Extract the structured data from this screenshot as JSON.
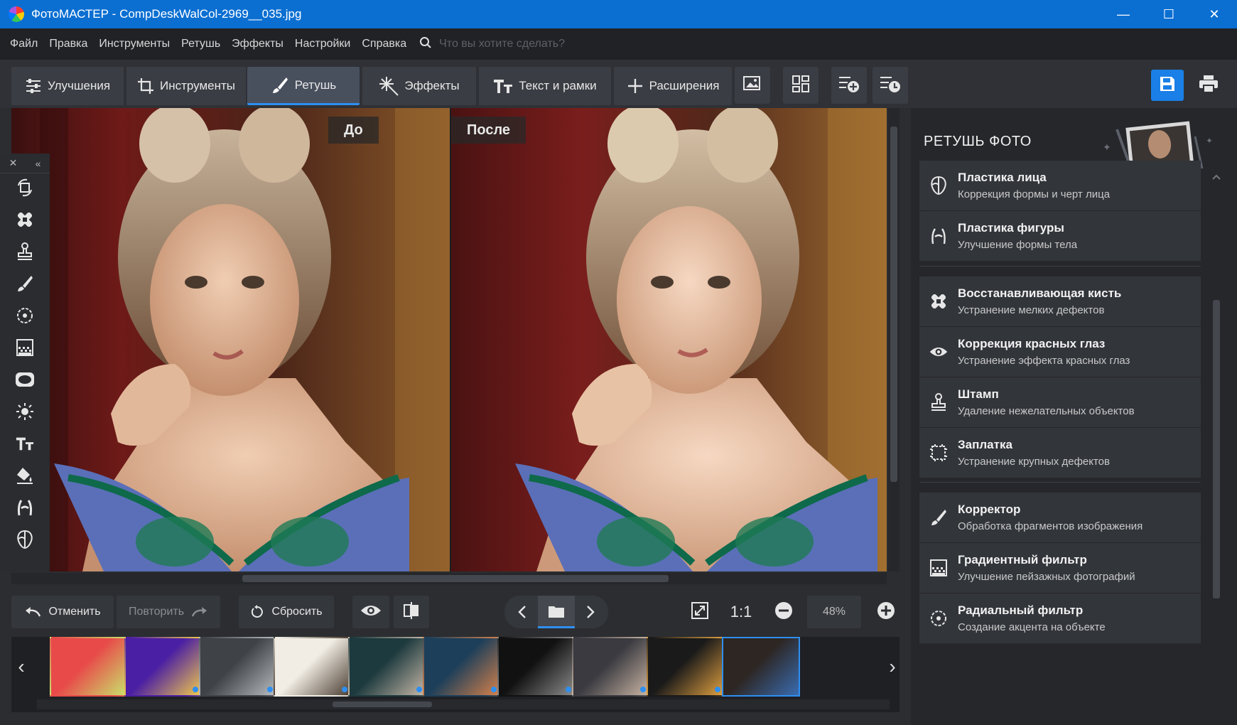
{
  "window": {
    "title": "ФотоМАСТЕР - CompDeskWalCol-2969__035.jpg",
    "minimize": "—",
    "maximize": "☐",
    "close": "✕"
  },
  "menu": {
    "items": [
      "Файл",
      "Правка",
      "Инструменты",
      "Ретушь",
      "Эффекты",
      "Настройки",
      "Справка"
    ],
    "search_placeholder": "Что вы хотите сделать?"
  },
  "toolbar": {
    "tabs": [
      {
        "label": "Улучшения",
        "icon": "sliders-icon"
      },
      {
        "label": "Инструменты",
        "icon": "crop-icon"
      },
      {
        "label": "Ретушь",
        "icon": "brush-icon",
        "active": true
      },
      {
        "label": "Эффекты",
        "icon": "sparkle-icon"
      },
      {
        "label": "Текст и рамки",
        "icon": "text-icon"
      },
      {
        "label": "Расширения",
        "icon": "plus-icon"
      }
    ],
    "icons": [
      "image-icon",
      "grid-icon",
      "add-adjust-icon",
      "time-adjust-icon",
      "save-icon",
      "print-icon"
    ]
  },
  "canvas": {
    "before_label": "До",
    "after_label": "После"
  },
  "palette": {
    "close": "✕",
    "collapse": "«",
    "tools": [
      "rotate-icon",
      "heal-icon",
      "stamp-icon",
      "brush-icon",
      "radial-icon",
      "gradient-icon",
      "vignette-icon",
      "sun-icon",
      "text-icon",
      "fill-icon",
      "body-icon",
      "face-icon"
    ]
  },
  "bottom": {
    "undo": "Отменить",
    "redo": "Повторить",
    "reset": "Сбросить",
    "zoom_one": "1:1",
    "zoom_value": "48%"
  },
  "filmstrip": {
    "thumbs": [
      {
        "name": "citrus",
        "colors": [
          "#e84a4a",
          "#c9e36b"
        ]
      },
      {
        "name": "cartoon",
        "colors": [
          "#4b1fa3",
          "#f2c94c"
        ]
      },
      {
        "name": "machinery",
        "colors": [
          "#3f4347",
          "#b8bcbf"
        ]
      },
      {
        "name": "cat-window",
        "colors": [
          "#f1ede4",
          "#4a3c30"
        ]
      },
      {
        "name": "kitten",
        "colors": [
          "#1d3a3e",
          "#c7b8a8"
        ]
      },
      {
        "name": "coast",
        "colors": [
          "#1d3f5a",
          "#d8824a"
        ]
      },
      {
        "name": "kittens-dark",
        "colors": [
          "#111111",
          "#8c8c8c"
        ]
      },
      {
        "name": "hands",
        "colors": [
          "#3a3a40",
          "#c9b5a4"
        ]
      },
      {
        "name": "camera",
        "colors": [
          "#1a1a1a",
          "#e0a040"
        ]
      },
      {
        "name": "portrait",
        "colors": [
          "#2d2622",
          "#3a6bb0"
        ],
        "selected": true
      }
    ]
  },
  "panel": {
    "title": "РЕТУШЬ ФОТО",
    "items": [
      {
        "title": "Пластика лица",
        "subtitle": "Коррекция формы и черт лица",
        "icon": "face-icon"
      },
      {
        "title": "Пластика фигуры",
        "subtitle": "Улучшение формы тела",
        "icon": "body-icon"
      },
      {
        "title": "Восстанавливающая кисть",
        "subtitle": "Устранение мелких дефектов",
        "icon": "heal-icon"
      },
      {
        "title": "Коррекция красных глаз",
        "subtitle": "Устранение эффекта красных глаз",
        "icon": "eye-icon"
      },
      {
        "title": "Штамп",
        "subtitle": "Удаление нежелательных объектов",
        "icon": "stamp-icon"
      },
      {
        "title": "Заплатка",
        "subtitle": "Устранение крупных дефектов",
        "icon": "patch-icon"
      },
      {
        "title": "Корректор",
        "subtitle": "Обработка фрагментов изображения",
        "icon": "brush-icon"
      },
      {
        "title": "Градиентный фильтр",
        "subtitle": "Улучшение пейзажных фотографий",
        "icon": "gradient-icon"
      },
      {
        "title": "Радиальный фильтр",
        "subtitle": "Создание акцента на объекте",
        "icon": "radial-icon"
      }
    ]
  },
  "colors": {
    "accent": "#2e8ff0",
    "titlebar": "#0b6fd2"
  }
}
